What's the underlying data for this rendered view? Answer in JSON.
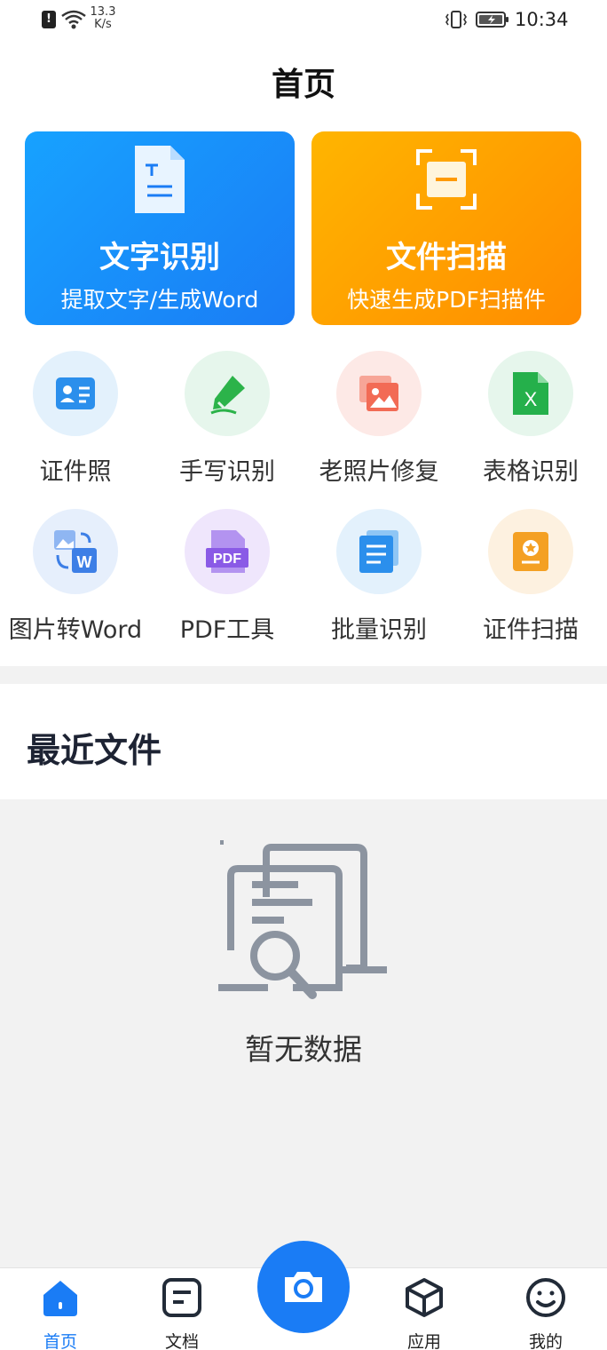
{
  "status_bar": {
    "alert_glyph": "!",
    "net_speed_value": "13.3",
    "net_speed_unit": "K/s",
    "time": "10:34",
    "icons": [
      "alert-icon",
      "wifi-icon",
      "vibrate-icon",
      "battery-icon"
    ]
  },
  "header": {
    "title": "首页"
  },
  "feature_cards": [
    {
      "title": "文字识别",
      "subtitle": "提取文字/生成Word",
      "icon": "text-document-icon",
      "color": "#1a8cff"
    },
    {
      "title": "文件扫描",
      "subtitle": "快速生成PDF扫描件",
      "icon": "scan-frame-icon",
      "color": "#ffa000"
    }
  ],
  "tools": [
    {
      "label": "证件照",
      "icon": "id-card-icon",
      "bg": "#e3f1fc",
      "color": "#2b8fec"
    },
    {
      "label": "手写识别",
      "icon": "pen-icon",
      "bg": "#e6f6ec",
      "color": "#2cb34a"
    },
    {
      "label": "老照片修复",
      "icon": "photo-icon",
      "bg": "#fde9e6",
      "color": "#f26b55"
    },
    {
      "label": "表格识别",
      "icon": "excel-icon",
      "bg": "#e6f6ec",
      "color": "#25b04b"
    },
    {
      "label": "图片转Word",
      "icon": "image-to-word-icon",
      "bg": "#e6effc",
      "color": "#3d7fe6"
    },
    {
      "label": "PDF工具",
      "icon": "pdf-icon",
      "bg": "#efe6fc",
      "color": "#8a5ae6"
    },
    {
      "label": "批量识别",
      "icon": "batch-icon",
      "bg": "#e3f1fc",
      "color": "#2b8fec"
    },
    {
      "label": "证件扫描",
      "icon": "certificate-icon",
      "bg": "#fdf1e0",
      "color": "#f4a023"
    }
  ],
  "recent": {
    "title": "最近文件",
    "empty_text": "暂无数据",
    "empty_icon": "empty-documents-icon"
  },
  "bottom_nav": [
    {
      "label": "首页",
      "icon": "home-icon",
      "active": true
    },
    {
      "label": "文档",
      "icon": "document-icon",
      "active": false
    },
    {
      "label": "应用",
      "icon": "cube-icon",
      "active": false
    },
    {
      "label": "我的",
      "icon": "smiley-icon",
      "active": false
    }
  ],
  "camera_button": {
    "icon": "camera-icon"
  },
  "accent_color": "#1a7cf5"
}
